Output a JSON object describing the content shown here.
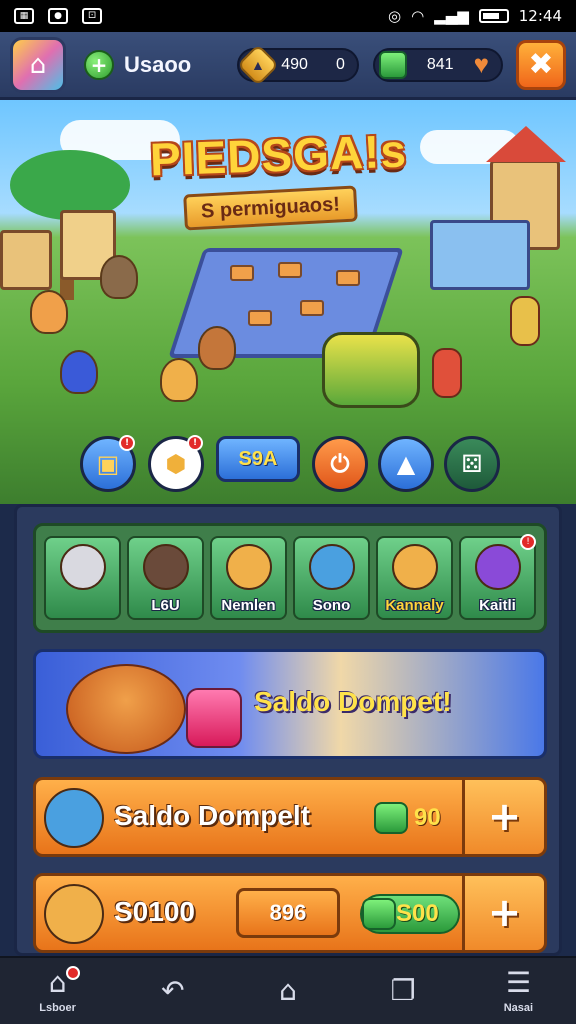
{
  "status_bar": {
    "time": "12:44",
    "icons": [
      "gallery-icon",
      "camera-icon",
      "grid-icon",
      "do-not-disturb-icon",
      "wifi-icon",
      "signal-icon",
      "battery-icon"
    ]
  },
  "hud": {
    "username": "Usaoo",
    "coins": "490",
    "coins_extra": "0",
    "gems": "841",
    "icons": {
      "home": "house-icon",
      "add": "plus-icon",
      "coin": "coin-icon",
      "gem": "gem-icon",
      "heart": "heart-icon",
      "close": "close-icon"
    }
  },
  "title": {
    "main": "PIEDSGA!s",
    "subtitle": "S permiguaos!"
  },
  "actions": {
    "items": [
      {
        "icon": "treasure-icon",
        "badge": "!"
      },
      {
        "icon": "gold-coin-icon",
        "badge": "!"
      },
      {
        "label": "S9A"
      },
      {
        "icon": "power-icon"
      },
      {
        "icon": "letter-a-icon"
      },
      {
        "icon": "dice-icon"
      }
    ]
  },
  "characters": [
    {
      "name": "",
      "color": "#d9d9e0"
    },
    {
      "name": "L6U",
      "color": "#6a4a3a"
    },
    {
      "name": "Nemlen",
      "color": "#f0b04a"
    },
    {
      "name": "Sono",
      "color": "#4aa0e0"
    },
    {
      "name": "Kannaly",
      "color": "#f0b04a"
    },
    {
      "name": "Kaitli",
      "color": "#8a4ad8",
      "badge": "!"
    }
  ],
  "promo": {
    "text": "Saldo Dompet!"
  },
  "wallet_row": {
    "title": "Saldo Dompelt",
    "amount": "90",
    "plus": "+"
  },
  "balance_row": {
    "title": "S0100",
    "value": "896",
    "amount": "S00",
    "plus": "+"
  },
  "nav": {
    "items": [
      {
        "label": "Lsboer",
        "icon": "home-icon",
        "glyph": "⌂"
      },
      {
        "label": "",
        "icon": "back-icon",
        "glyph": "↶"
      },
      {
        "label": "",
        "icon": "home-outline-icon",
        "glyph": "⌂"
      },
      {
        "label": "",
        "icon": "recents-icon",
        "glyph": "❐"
      },
      {
        "label": "Nasai",
        "icon": "menu-icon",
        "glyph": "☰"
      }
    ]
  },
  "colors": {
    "accent_orange": "#f08a2a",
    "panel": "#2b3a5e",
    "gem_green": "#2b9a3b",
    "coin_gold": "#ffd25a"
  }
}
